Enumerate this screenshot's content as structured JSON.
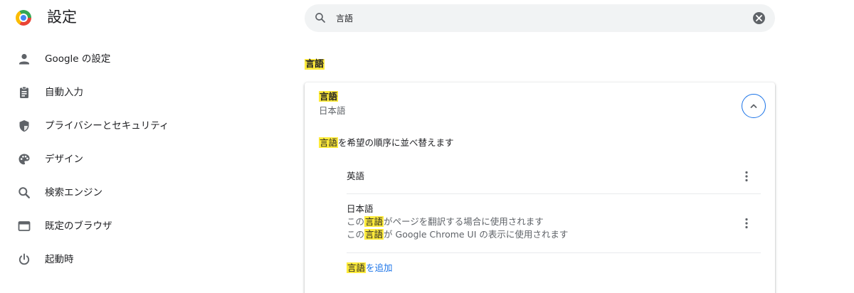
{
  "header": {
    "title": "設定",
    "logo_icon": "chrome-logo-icon",
    "search": {
      "value": "言語",
      "icon": "search-icon",
      "clear_icon": "clear-icon"
    }
  },
  "sidebar": {
    "items": [
      {
        "label": "Google の設定",
        "icon": "person-icon"
      },
      {
        "label": "自動入力",
        "icon": "clipboard-icon"
      },
      {
        "label": "プライバシーとセキュリティ",
        "icon": "shield-icon"
      },
      {
        "label": "デザイン",
        "icon": "palette-icon"
      },
      {
        "label": "検索エンジン",
        "icon": "search-icon"
      },
      {
        "label": "既定のブラウザ",
        "icon": "browser-window-icon"
      },
      {
        "label": "起動時",
        "icon": "power-icon"
      }
    ]
  },
  "main": {
    "section_heading": "言語",
    "card": {
      "title": "言語",
      "subtitle": "日本語",
      "reorder": {
        "highlight": "言語",
        "rest": "を希望の順序に並べ替えます"
      },
      "languages": [
        {
          "name": "英語"
        },
        {
          "name": "日本語",
          "desc1": {
            "pre": "この",
            "highlight": "言語",
            "post": "がページを翻訳する場合に使用されます"
          },
          "desc2": {
            "pre": "この",
            "highlight": "言語",
            "post": "が Google Chrome UI の表示に使用されます"
          }
        }
      ],
      "add_language": {
        "highlight": "言語",
        "rest": "を追加"
      }
    }
  },
  "colors": {
    "highlight": "#ffeb3b",
    "accent": "#1a73e8",
    "icon": "#5f6368",
    "text": "#202124"
  }
}
